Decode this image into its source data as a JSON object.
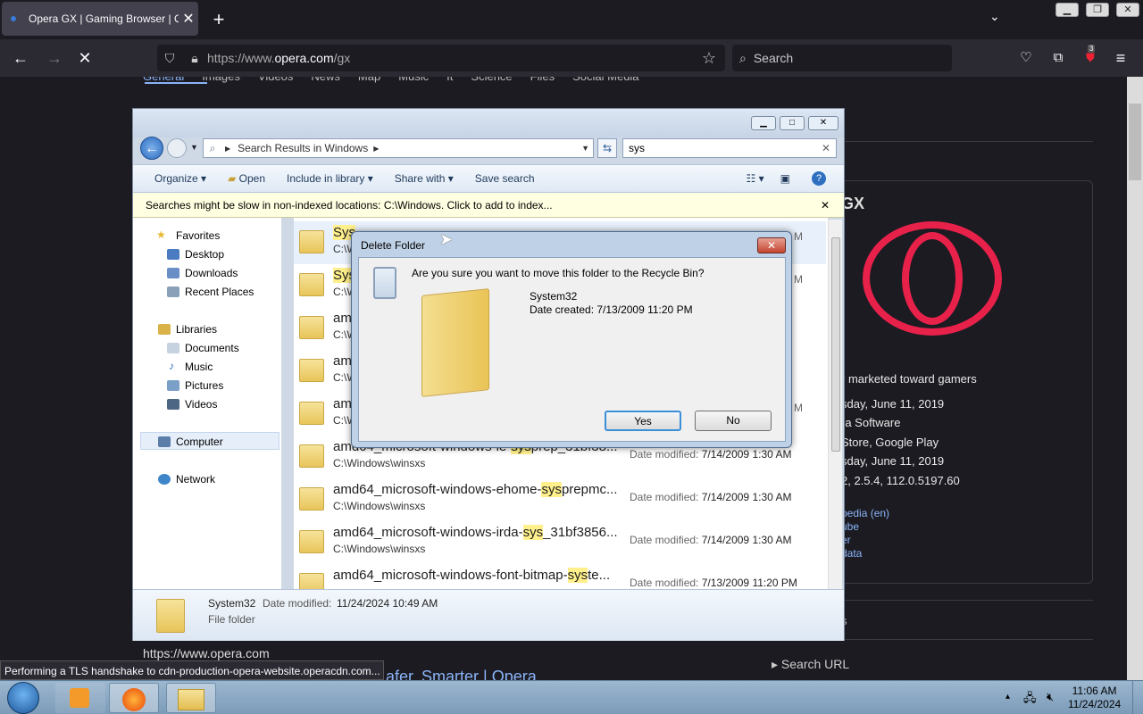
{
  "browser": {
    "tab_title": "Opera GX | Gaming Browser | O",
    "url_prefix": "https://www.",
    "url_domain": "opera.com",
    "url_suffix": "/gx",
    "search_placeholder": "Search",
    "badge": "3"
  },
  "page": {
    "nav_items": [
      "General",
      "Images",
      "Videos",
      "News",
      "Map",
      "Music",
      "It",
      "Science",
      "Files",
      "Social Media"
    ],
    "right_panel": {
      "title_fragment": "GX",
      "desc_fragment": "r marketed toward gamers",
      "facts": [
        "sday, June 11, 2019",
        "ra Software",
        "Store, Google Play",
        "sday, June 11, 2019",
        "2, 2.5.4, 112.0.5197.60"
      ],
      "links": [
        "pedia (en)",
        "ube",
        "er",
        "data"
      ],
      "search_url": "Search URL",
      "s_fragment": "s"
    },
    "result_url": "https://www.opera.com",
    "result_title": "afer, Smarter | Opera"
  },
  "explorer": {
    "address": "Search Results in Windows",
    "search_value": "sys",
    "toolbar": {
      "organize": "Organize",
      "open": "Open",
      "include": "Include in library",
      "share": "Share with",
      "save_search": "Save search"
    },
    "infobar": "Searches might be slow in non-indexed locations: C:\\Windows. Click to add to index...",
    "nav": {
      "favorites": "Favorites",
      "desktop": "Desktop",
      "downloads": "Downloads",
      "recent": "Recent Places",
      "libraries": "Libraries",
      "documents": "Documents",
      "music": "Music",
      "pictures": "Pictures",
      "videos": "Videos",
      "computer": "Computer",
      "network": "Network"
    },
    "files": [
      {
        "pre": "",
        "hl": "Sys",
        "post": "",
        "path": "C:\\W",
        "date_label": "",
        "date": "M"
      },
      {
        "pre": "",
        "hl": "Sys",
        "post": "",
        "path": "C:\\W",
        "date_label": "",
        "date": "M"
      },
      {
        "pre": "am",
        "hl": "",
        "post": "",
        "path": "C:\\W",
        "date_label": "",
        "date": ""
      },
      {
        "pre": "am",
        "hl": "",
        "post": "",
        "path": "C:\\W",
        "date_label": "",
        "date": ""
      },
      {
        "pre": "am",
        "hl": "",
        "post": "",
        "path": "C:\\W",
        "date_label": "",
        "date": "M"
      },
      {
        "pre": "amd64_microsoft-windows-ie-",
        "hl": "sys",
        "post": "prep_31bf38...",
        "path": "C:\\Windows\\winsxs",
        "date_label": "Date modified:",
        "date": "7/14/2009 1:30 AM"
      },
      {
        "pre": "amd64_microsoft-windows-ehome-",
        "hl": "sys",
        "post": "prepmc...",
        "path": "C:\\Windows\\winsxs",
        "date_label": "Date modified:",
        "date": "7/14/2009 1:30 AM"
      },
      {
        "pre": "amd64_microsoft-windows-irda-",
        "hl": "sys",
        "post": "_31bf3856...",
        "path": "C:\\Windows\\winsxs",
        "date_label": "Date modified:",
        "date": "7/14/2009 1:30 AM"
      },
      {
        "pre": "amd64_microsoft-windows-font-bitmap-",
        "hl": "sys",
        "post": "te...",
        "path": "",
        "date_label": "Date modified:",
        "date": "7/13/2009 11:20 PM"
      }
    ],
    "details": {
      "name": "System32",
      "date_label": "Date modified:",
      "date": "11/24/2024 10:49 AM",
      "type": "File folder"
    }
  },
  "dialog": {
    "title": "Delete Folder",
    "question": "Are you sure you want to move this folder to the Recycle Bin?",
    "folder_name": "System32",
    "folder_date": "Date created: 7/13/2009 11:20 PM",
    "yes": "Yes",
    "no": "No"
  },
  "status_text": "Performing a TLS handshake to cdn-production-opera-website.operacdn.com...",
  "taskbar": {
    "time": "11:06 AM",
    "date": "11/24/2024"
  }
}
